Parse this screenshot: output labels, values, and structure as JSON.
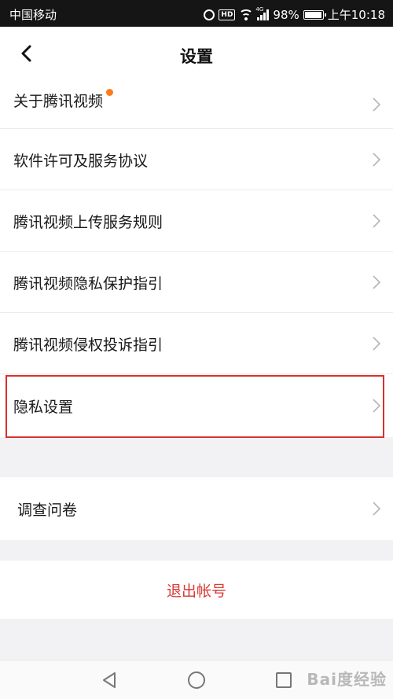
{
  "status_bar": {
    "carrier": "中国移动",
    "battery": "98%",
    "time": "上午10:18",
    "hd_badge": "HD",
    "network": "4G"
  },
  "header": {
    "title": "设置",
    "back_icon": "chevron-left-icon"
  },
  "settings": {
    "items": [
      {
        "label": "关于腾讯视频",
        "has_dot": true
      },
      {
        "label": "软件许可及服务协议"
      },
      {
        "label": "腾讯视频上传服务规则"
      },
      {
        "label": "腾讯视频隐私保护指引"
      },
      {
        "label": "腾讯视频侵权投诉指引"
      },
      {
        "label": "隐私设置",
        "highlighted": true
      }
    ],
    "survey_label": "调查问卷",
    "logout_label": "退出帐号"
  },
  "colors": {
    "accent_red": "#d83a36",
    "dot_orange": "#ff7a1a",
    "highlight_border": "#d8302e"
  },
  "watermark": "Bai度经验"
}
